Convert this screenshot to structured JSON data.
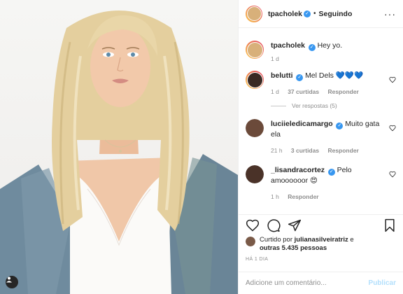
{
  "post": {
    "username": "tpacholek",
    "follow_state": "Seguindo",
    "verified_glyph": "✓",
    "more_icon": "more-dots-icon"
  },
  "comments": [
    {
      "user": "tpacholek",
      "text": "Hey yo.",
      "time": "1 d",
      "likes": "",
      "reply": "",
      "avatar_color": "#d8b07a"
    },
    {
      "user": "belutti",
      "text": "Mel Dels 💙💙💙",
      "time": "1 d",
      "likes": "37 curtidas",
      "reply": "Responder",
      "view_replies": "Ver respostas (5)",
      "avatar_color": "#3a2a24"
    },
    {
      "user": "luciieledicamargo",
      "text": "Muito gata ela",
      "time": "21 h",
      "likes": "3 curtidas",
      "reply": "Responder",
      "avatar_color": "#6b4a3a"
    },
    {
      "user": "_lisandracortez",
      "text": "Pelo amoooooor 😍",
      "time": "1 h",
      "likes": "",
      "reply": "Responder",
      "avatar_color": "#4a3228"
    }
  ],
  "actions": {
    "liked_by_prefix": "Curtido por",
    "liked_by_user": "julianasilveiratriz",
    "liked_by_suffix": "e",
    "likes_others": "outras 5.435 pessoas",
    "date": "HÁ 1 DIA"
  },
  "add_comment": {
    "placeholder": "Adicione um comentário...",
    "publish": "Publicar"
  },
  "colors": {
    "accent": "#3897f0",
    "muted": "#8e8e8e",
    "publish_disabled": "#b2dffc"
  }
}
